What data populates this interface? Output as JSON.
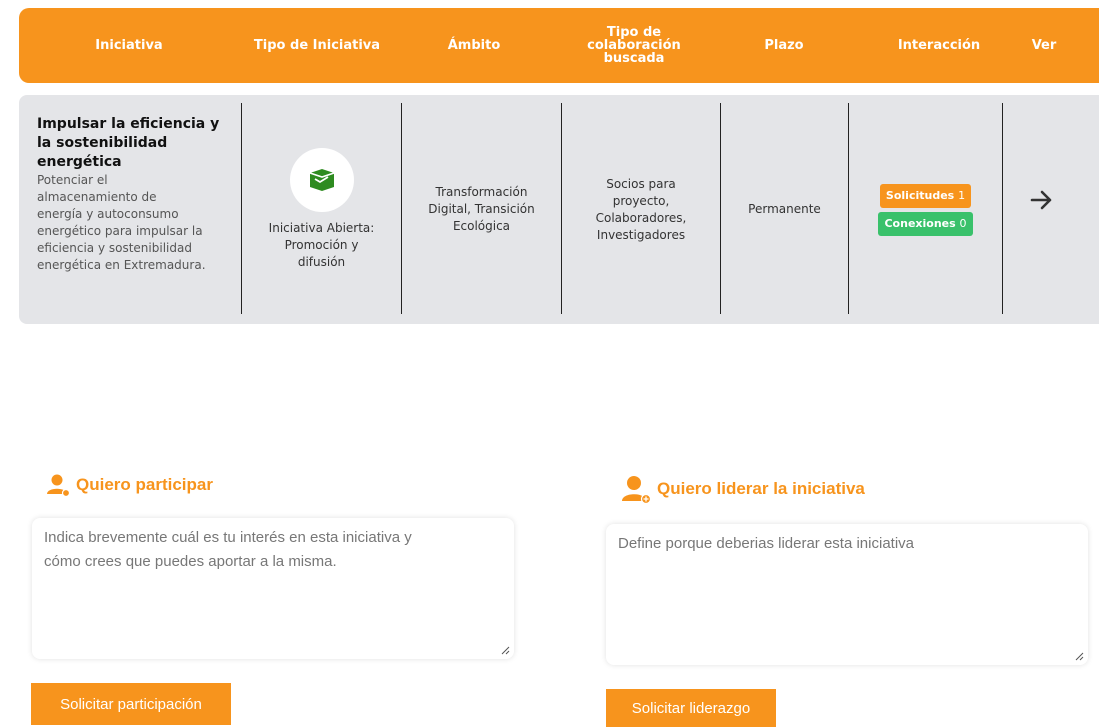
{
  "table": {
    "headers": {
      "iniciativa": "Iniciativa",
      "tipo": "Tipo de Iniciativa",
      "ambito": "Ámbito",
      "colab_1": "Tipo de",
      "colab_2": "colaboración",
      "colab_3": "buscada",
      "plazo": "Plazo",
      "interaccion": "Interacción",
      "ver": "Ver"
    },
    "row": {
      "title_1": "Impulsar la eficiencia y",
      "title_2": "la sostenibilidad",
      "title_3": "energética",
      "desc_1": "Potenciar el",
      "desc_2": "almacenamiento de",
      "desc_3": "energía y autoconsumo",
      "desc_4": "energético para impulsar la",
      "desc_5": "eficiencia y sostenibilidad",
      "desc_6": "energética en Extremadura.",
      "tipo_icon": "open-box-icon",
      "tipo_1": "Iniciativa Abierta:",
      "tipo_2": "Promoción y",
      "tipo_3": "difusión",
      "ambito_1": "Transformación",
      "ambito_2": "Digital, Transición",
      "ambito_3": "Ecológica",
      "colab_1": "Socios para",
      "colab_2": "proyecto,",
      "colab_3": "Colaboradores,",
      "colab_4": "Investigadores",
      "plazo": "Permanente",
      "solicitudes_label": "Solicitudes",
      "solicitudes_count": "1",
      "conexiones_label": "Conexiones",
      "conexiones_count": "0",
      "ver_icon": "arrow-right-icon"
    }
  },
  "participar": {
    "icon": "user-icon",
    "title": "Quiero participar",
    "placeholder_1": "Indica brevemente cuál es tu interés en esta iniciativa y",
    "placeholder_2": "cómo crees que puedes aportar a la misma.",
    "button": "Solicitar participación"
  },
  "liderar": {
    "icon": "user-add-icon",
    "title": "Quiero liderar la iniciativa",
    "placeholder": "Define porque deberias liderar esta iniciativa",
    "button": "Solicitar liderazgo"
  },
  "colors": {
    "accent": "#f7941d",
    "row_bg": "#e4e5e8",
    "success": "#39c16b",
    "icon_green": "#2e8b20"
  }
}
